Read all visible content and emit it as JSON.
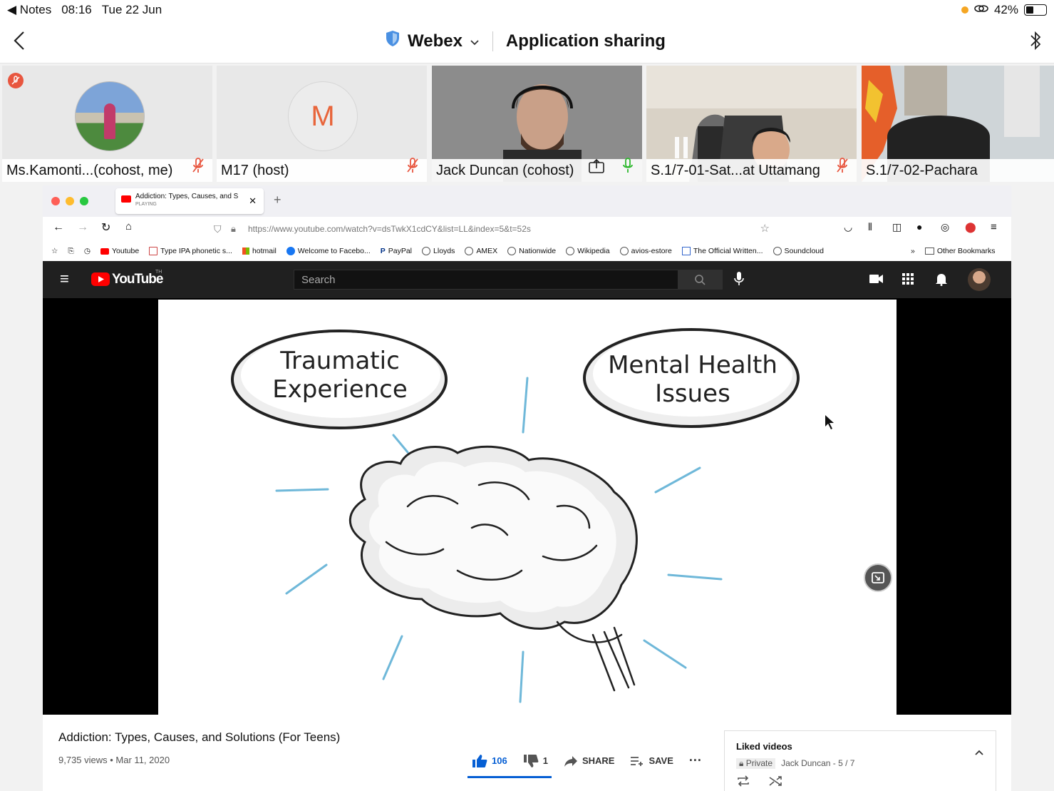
{
  "status_bar": {
    "back_app": "Notes",
    "time": "08:16",
    "date": "Tue 22 Jun",
    "battery": "42%"
  },
  "header": {
    "app_name": "Webex",
    "title": "Application sharing"
  },
  "participants": [
    {
      "name": "Ms.Kamonti...(cohost, me)",
      "mic": "muted"
    },
    {
      "name": "M17 (host)",
      "avatar_letter": "M",
      "mic": "muted"
    },
    {
      "name": "Jack Duncan (cohost)",
      "mic": "active"
    },
    {
      "name": "S.1/7-01-Sat...at Uttamang",
      "mic": "muted"
    },
    {
      "name": "S.1/7-02-Pachara",
      "mic": "none"
    }
  ],
  "browser": {
    "tab_title": "Addiction: Types, Causes, and S",
    "tab_status": "PLAYING",
    "url": "https://www.youtube.com/watch?v=dsTwkX1cdCY&list=LL&index=5&t=52s",
    "bookmarks": [
      "Youtube",
      "Type IPA phonetic s...",
      "hotmail",
      "Welcome to Facebo...",
      "PayPal",
      "Lloyds",
      "AMEX",
      "Nationwide",
      "Wikipedia",
      "avios-estore",
      "The Official Written...",
      "Soundcloud"
    ],
    "other_bookmarks": "Other Bookmarks"
  },
  "youtube": {
    "logo": "YouTube",
    "logo_mark": "TH",
    "search_placeholder": "Search",
    "video_bubble_left": [
      "Traumatic",
      "Experience"
    ],
    "video_bubble_right": [
      "Mental Health",
      "Issues"
    ],
    "video_title": "Addiction: Types, Causes, and Solutions (For Teens)",
    "video_meta": "9,735 views • Mar 11, 2020",
    "likes": "106",
    "dislikes": "1",
    "share_label": "SHARE",
    "save_label": "SAVE",
    "playlist_title": "Liked videos",
    "playlist_privacy": "Private",
    "playlist_owner": "Jack Duncan - 5 / 7"
  }
}
